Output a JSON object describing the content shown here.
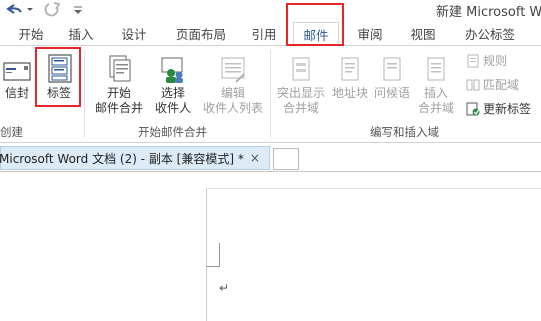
{
  "window": {
    "title": "新建 Microsoft Wo"
  },
  "tabs": [
    {
      "label": "开始"
    },
    {
      "label": "插入"
    },
    {
      "label": "设计"
    },
    {
      "label": "页面布局"
    },
    {
      "label": "引用"
    },
    {
      "label": "邮件",
      "active": true
    },
    {
      "label": "审阅"
    },
    {
      "label": "视图"
    },
    {
      "label": "办公标签"
    }
  ],
  "ribbon": {
    "create": {
      "label": "创建",
      "envelopes": "信封",
      "labels": "标签"
    },
    "start_mail_merge": {
      "label": "开始邮件合并",
      "start_line1": "开始",
      "start_line2": "邮件合并",
      "select_line1": "选择",
      "select_line2": "收件人",
      "edit_line1": "编辑",
      "edit_line2": "收件人列表"
    },
    "write_insert": {
      "label": "编写和插入域",
      "highlight_line1": "突出显示",
      "highlight_line2": "合并域",
      "address_block": "地址块",
      "greeting_line": "问候语",
      "insert_line1": "插入",
      "insert_line2": "合并域",
      "rules": "规则",
      "match_fields": "匹配域",
      "update_labels": "更新标签"
    }
  },
  "document_tab": {
    "title": "Microsoft Word 文档 (2) - 副本 [兼容模式] *",
    "close": "×"
  },
  "paragraph_mark": "↵",
  "colors": {
    "accent": "#2b579a",
    "highlight_box": "#e5262b",
    "doc_tab_bg": "#dcebf6"
  }
}
